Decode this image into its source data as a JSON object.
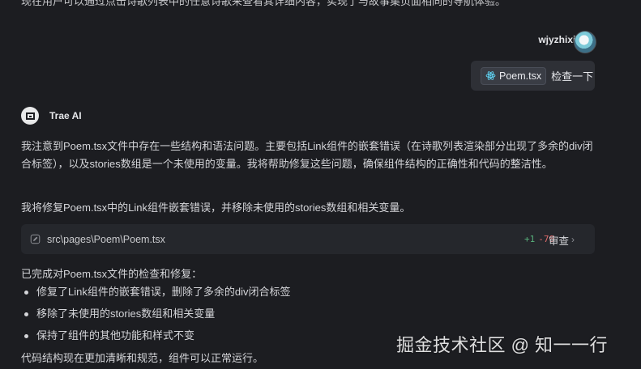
{
  "previous_message": {
    "text": "现在用户可以通过点击诗歌列表中的任意诗歌来查看其详细内容，实现了与故事集页面相同的导航体验。"
  },
  "user_message": {
    "username": "wjyzhixing",
    "file_chip": "Poem.tsx",
    "text": "检查一下"
  },
  "assistant": {
    "name": "Trae AI",
    "paragraph_1": "我注意到Poem.tsx文件中存在一些结构和语法问题。主要包括Link组件的嵌套错误（在诗歌列表渲染部分出现了多余的div闭合标签），以及stories数组是一个未使用的变量。我将帮助修复这些问题，确保组件结构的正确性和代码的整洁性。",
    "paragraph_2": "我将修复Poem.tsx中的Link组件嵌套错误，并移除未使用的stories数组和相关变量。",
    "file_change": {
      "path": "src\\pages\\Poem\\Poem.tsx",
      "added": "+1",
      "removed": "-70",
      "review_label": "审查"
    },
    "summary_title": "已完成对Poem.tsx文件的检查和修复：",
    "summary_items": [
      "修复了Link组件的嵌套错误，删除了多余的div闭合标签",
      "移除了未使用的stories数组和相关变量",
      "保持了组件的其他功能和样式不变"
    ],
    "closing": "代码结构现在更加清晰和规范，组件可以正常运行。"
  },
  "watermark": "掘金技术社区 @ 知一一行",
  "icons": {
    "file_chip_icon": "react-icon",
    "file_change_icon": "pencil-icon",
    "review_chevron": "chevron-right-icon",
    "assistant_logo": "trae-logo-icon"
  },
  "colors": {
    "background": "#1c1d21",
    "added": "#57b07a",
    "removed": "#e06b6b",
    "react_icon": "#61dafb"
  }
}
